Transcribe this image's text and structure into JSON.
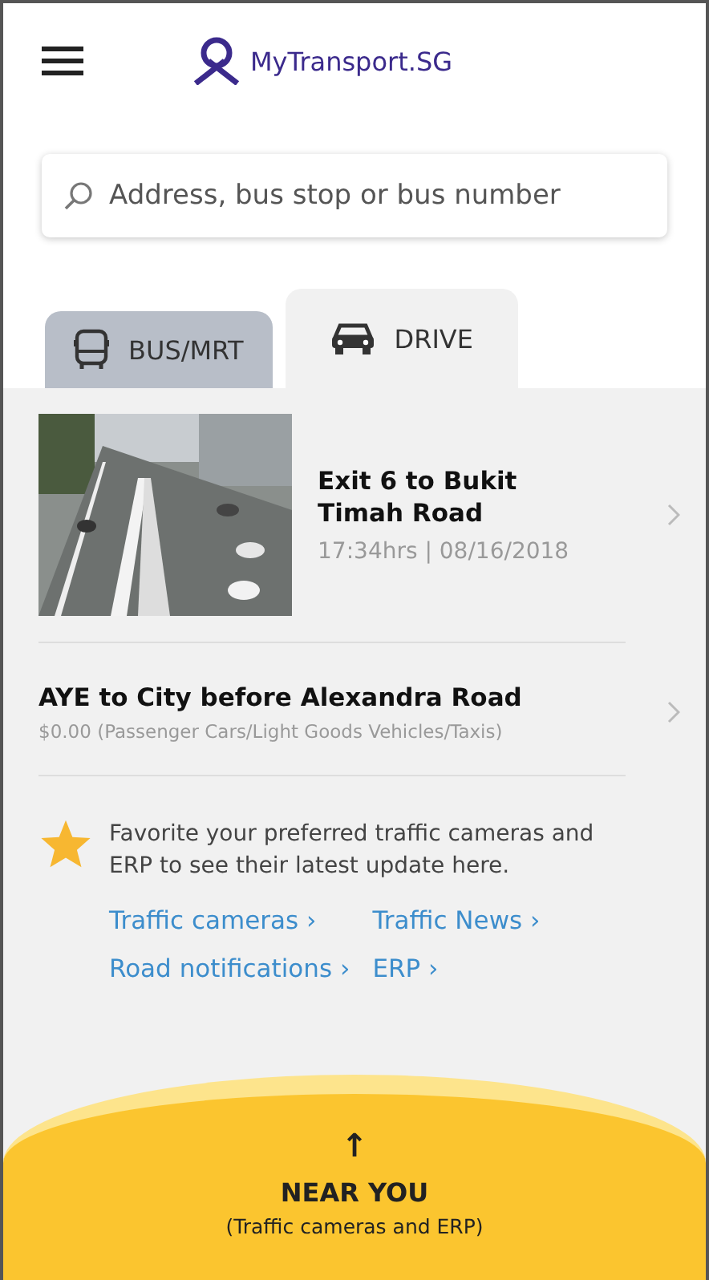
{
  "header": {
    "title": "MyTransport.SG"
  },
  "search": {
    "placeholder": "Address, bus stop or bus number"
  },
  "tabs": [
    {
      "label": "BUS/MRT",
      "kind": "bus",
      "selected": false
    },
    {
      "label": "DRIVE",
      "kind": "car",
      "selected": true
    }
  ],
  "items": [
    {
      "kind": "camera",
      "title": "Exit 6 to Bukit Timah Road",
      "subtitle": "17:34hrs | 08/16/2018"
    },
    {
      "kind": "erp",
      "title": "AYE to City before Alexandra Road",
      "subtitle": "$0.00 (Passenger Cars/Light Goods Vehicles/Taxis)"
    }
  ],
  "favorites": {
    "message": "Favorite your preferred traffic cameras and ERP to see their latest update here.",
    "links": [
      "Traffic cameras ›",
      "Traffic News ›",
      "Road notifications ›",
      "ERP ›"
    ]
  },
  "near_you": {
    "arrow": "↑",
    "title": "NEAR YOU",
    "subtitle": "(Traffic cameras and ERP)"
  }
}
